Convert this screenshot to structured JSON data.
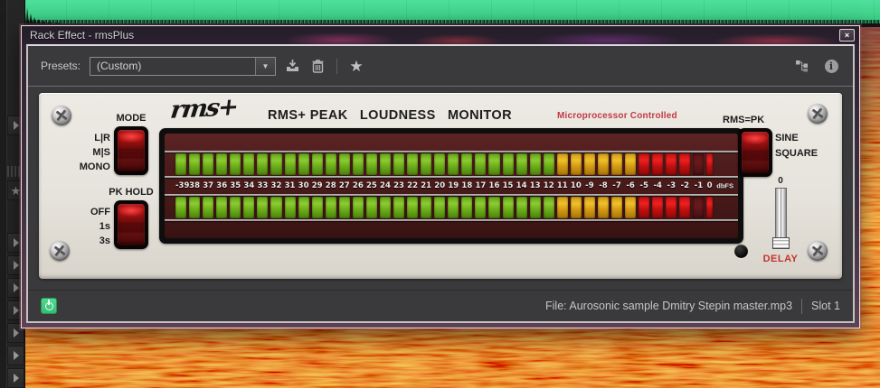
{
  "window": {
    "title": "Rack Effect - rmsPlus",
    "close_icon": "×"
  },
  "presets": {
    "label": "Presets:",
    "value": "(Custom)",
    "dropdown_arrow": "▼",
    "favorite_icon": "★",
    "icons": [
      "save-preset-icon",
      "delete-preset-icon",
      "favorite-icon",
      "routing-icon",
      "info-icon"
    ]
  },
  "plugin": {
    "brand": "rms+",
    "title": "RMS+ PEAK   LOUDNESS   MONITOR",
    "subtitle": "Microprocessor Controlled",
    "mode": {
      "label": "MODE",
      "options": [
        "L|R",
        "M|S",
        "MONO"
      ]
    },
    "pk_hold": {
      "label": "PK HOLD",
      "options": [
        "OFF",
        "1s",
        "3s"
      ]
    },
    "rms_pk": {
      "label": "RMS=PK",
      "options": [
        "SINE",
        "SQUARE"
      ]
    },
    "delay": {
      "label": "DELAY",
      "value": "0"
    },
    "meter": {
      "unit": "dbFS",
      "labels": [
        "-39",
        "38",
        "37",
        "36",
        "35",
        "34",
        "33",
        "32",
        "31",
        "30",
        "29",
        "28",
        "27",
        "26",
        "25",
        "24",
        "23",
        "22",
        "21",
        "20",
        "19",
        "18",
        "17",
        "16",
        "15",
        "14",
        "13",
        "12",
        "11",
        "10",
        "-9",
        "-8",
        "-7",
        "-6",
        "-5",
        "-4",
        "-3",
        "-2",
        "-1",
        "0"
      ],
      "zone_counts": {
        "green": 28,
        "yellow": 6,
        "red": 6
      },
      "rows": [
        {
          "id": "top",
          "unlit_indices": [
            38
          ]
        },
        {
          "id": "bottom",
          "unlit_indices": [
            38
          ]
        }
      ],
      "narrow_last": true
    },
    "colors": {
      "green_led": "#8ccb33",
      "yellow_led": "#f0c02a",
      "red_led": "#ef2020",
      "faceplate": "#e8e5de",
      "meter_background": "#4d1c1c",
      "accent_red_text": "#c13a44"
    }
  },
  "footer": {
    "file": "File: Aurosonic sample Dmitry Stepin master.mp3",
    "slot": "Slot 1"
  }
}
